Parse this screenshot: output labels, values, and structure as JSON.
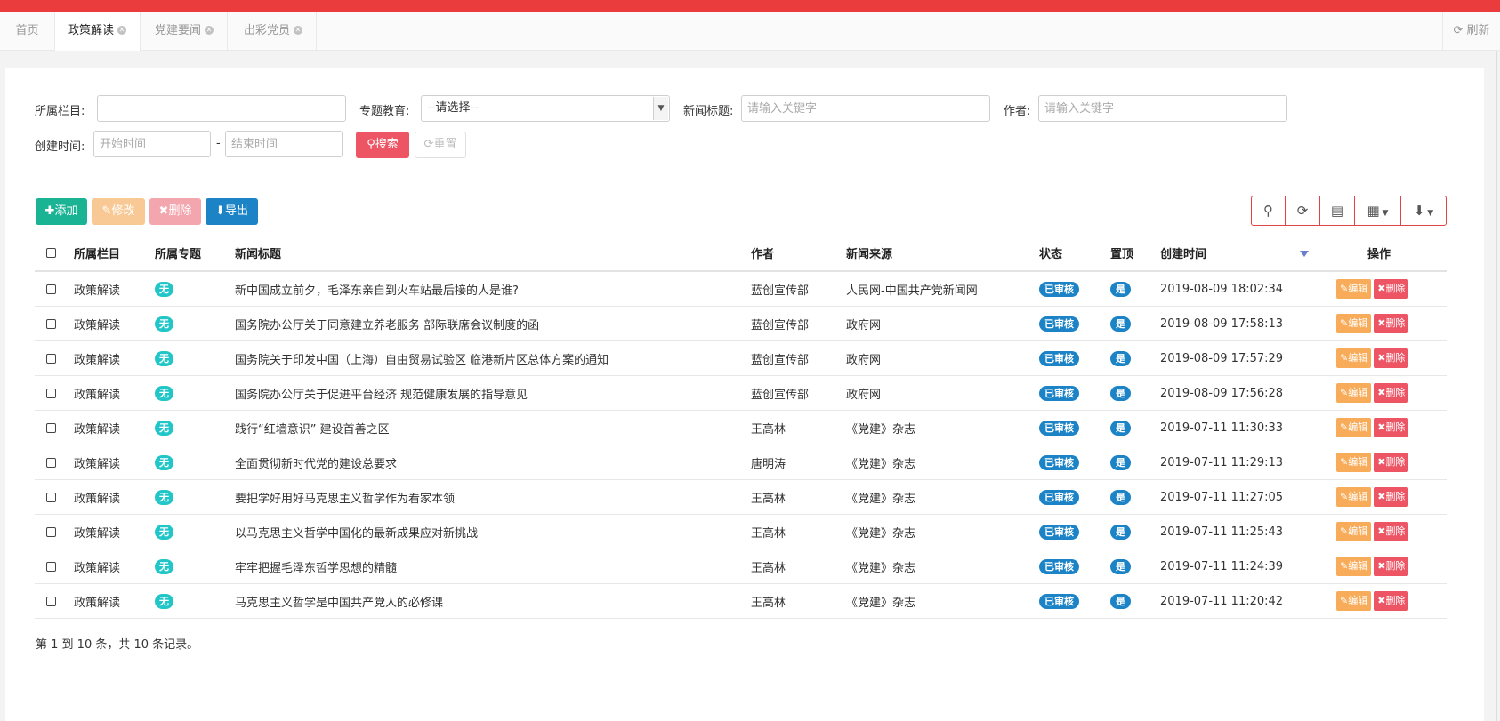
{
  "tabs": [
    {
      "label": "首页",
      "closable": false
    },
    {
      "label": "政策解读",
      "closable": true,
      "active": true
    },
    {
      "label": "党建要闻",
      "closable": true
    },
    {
      "label": "出彩党员",
      "closable": true
    }
  ],
  "refresh_label": "刷新",
  "search": {
    "column_label": "所属栏目:",
    "column_value": "",
    "topic_label": "专题教育:",
    "topic_selected": "--请选择--",
    "title_label": "新闻标题:",
    "title_placeholder": "请输入关键字",
    "author_label": "作者:",
    "author_placeholder": "请输入关键字",
    "created_label": "创建时间:",
    "start_placeholder": "开始时间",
    "dash": "-",
    "end_placeholder": "结束时间",
    "search_button": "搜索",
    "reset_button": "重置"
  },
  "toolbar": {
    "add": "添加",
    "edit": "修改",
    "delete": "删除",
    "export": "导出"
  },
  "table": {
    "headers": {
      "column": "所属栏目",
      "topic": "所属专题",
      "title": "新闻标题",
      "author": "作者",
      "source": "新闻来源",
      "status": "状态",
      "top": "置顶",
      "created": "创建时间",
      "actions": "操作"
    },
    "rows": [
      {
        "column": "政策解读",
        "topic": "无",
        "title": "新中国成立前夕，毛泽东亲自到火车站最后接的人是谁?",
        "author": "蓝创宣传部",
        "source": "人民网-中国共产党新闻网",
        "status": "已审核",
        "top": "是",
        "created": "2019-08-09 18:02:34"
      },
      {
        "column": "政策解读",
        "topic": "无",
        "title": "国务院办公厅关于同意建立养老服务 部际联席会议制度的函",
        "author": "蓝创宣传部",
        "source": "政府网",
        "status": "已审核",
        "top": "是",
        "created": "2019-08-09 17:58:13"
      },
      {
        "column": "政策解读",
        "topic": "无",
        "title": "国务院关于印发中国（上海）自由贸易试验区 临港新片区总体方案的通知",
        "author": "蓝创宣传部",
        "source": "政府网",
        "status": "已审核",
        "top": "是",
        "created": "2019-08-09 17:57:29"
      },
      {
        "column": "政策解读",
        "topic": "无",
        "title": "国务院办公厅关于促进平台经济 规范健康发展的指导意见",
        "author": "蓝创宣传部",
        "source": "政府网",
        "status": "已审核",
        "top": "是",
        "created": "2019-08-09 17:56:28"
      },
      {
        "column": "政策解读",
        "topic": "无",
        "title": "践行“红墙意识” 建设首善之区",
        "author": "王高林",
        "source": "《党建》杂志",
        "status": "已审核",
        "top": "是",
        "created": "2019-07-11 11:30:33"
      },
      {
        "column": "政策解读",
        "topic": "无",
        "title": "全面贯彻新时代党的建设总要求",
        "author": "唐明涛",
        "source": "《党建》杂志",
        "status": "已审核",
        "top": "是",
        "created": "2019-07-11 11:29:13"
      },
      {
        "column": "政策解读",
        "topic": "无",
        "title": "要把学好用好马克思主义哲学作为看家本领",
        "author": "王高林",
        "source": "《党建》杂志",
        "status": "已审核",
        "top": "是",
        "created": "2019-07-11 11:27:05"
      },
      {
        "column": "政策解读",
        "topic": "无",
        "title": "以马克思主义哲学中国化的最新成果应对新挑战",
        "author": "王高林",
        "source": "《党建》杂志",
        "status": "已审核",
        "top": "是",
        "created": "2019-07-11 11:25:43"
      },
      {
        "column": "政策解读",
        "topic": "无",
        "title": "牢牢把握毛泽东哲学思想的精髓",
        "author": "王高林",
        "source": "《党建》杂志",
        "status": "已审核",
        "top": "是",
        "created": "2019-07-11 11:24:39"
      },
      {
        "column": "政策解读",
        "topic": "无",
        "title": "马克思主义哲学是中国共产党人的必修课",
        "author": "王高林",
        "source": "《党建》杂志",
        "status": "已审核",
        "top": "是",
        "created": "2019-07-11 11:20:42"
      }
    ],
    "edit_label": "编辑",
    "delete_label": "删除"
  },
  "pagination_text": "第 1 到 10 条，共 10 条记录。",
  "icons": {
    "search": "search-icon",
    "refresh": "refresh-icon",
    "toggle": "list-icon",
    "columns": "columns-icon",
    "export": "download-icon"
  },
  "colors": {
    "top_bar": "#ea3b3d",
    "add": "#1ab394",
    "edit": "#f8ac59",
    "delete": "#ed5565",
    "export": "#1c84c6",
    "badge_cyan": "#23c6c8",
    "badge_blue": "#1c84c6"
  }
}
